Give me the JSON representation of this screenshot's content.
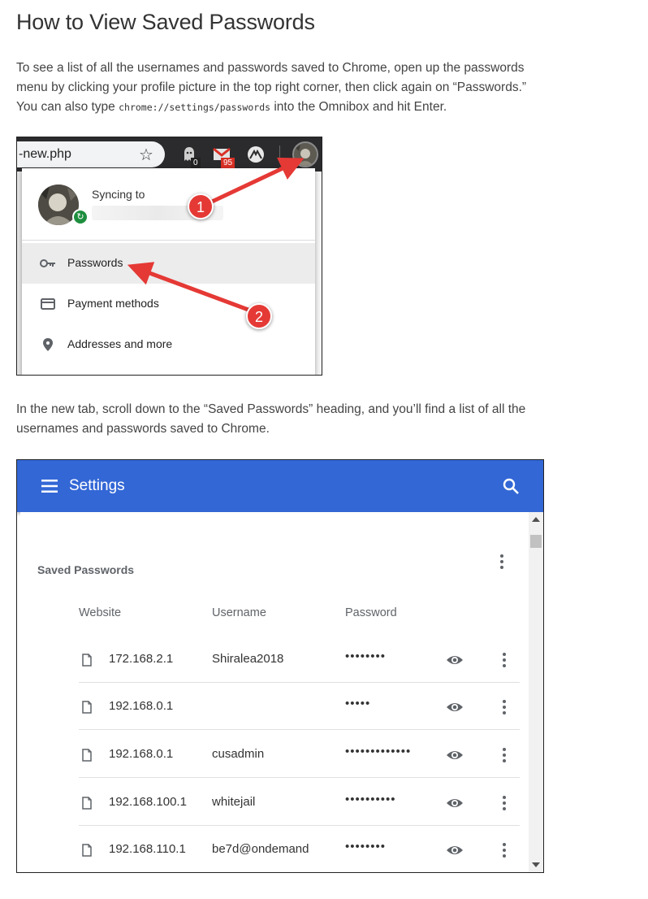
{
  "article": {
    "title": "How to View Saved Passwords",
    "para1": {
      "line1": "To see a list of all the usernames and passwords saved to Chrome, open up the passwords",
      "line2": "menu by clicking your profile picture in the top right corner, then click again on “Passwords.”",
      "line3_before": "You can also type ",
      "line3_code": "chrome://settings/passwords",
      "line3_after": " into the Omnibox and hit Enter."
    },
    "para2": {
      "line1": "In the new tab, scroll down to the “Saved Passwords” heading, and you’ll find a list of all the",
      "line2": "usernames and passwords saved to Chrome."
    }
  },
  "figure1": {
    "omnibox_text": "-new.php",
    "star_icon": "star-icon",
    "ghost_badge": "0",
    "mail_badge": "95",
    "sync_label": "Syncing to",
    "menu_items": [
      {
        "label": "Passwords",
        "icon": "key-icon"
      },
      {
        "label": "Payment methods",
        "icon": "credit-card-icon"
      },
      {
        "label": "Addresses and more",
        "icon": "location-pin-icon"
      }
    ],
    "steps": [
      "1",
      "2"
    ],
    "colors": {
      "toolbar": "#2b2b2d",
      "callout": "#e53935",
      "sync_badge": "#1e8e3e"
    }
  },
  "figure2": {
    "header_title": "Settings",
    "section_title": "Saved Passwords",
    "columns": {
      "website": "Website",
      "username": "Username",
      "password": "Password"
    },
    "rows": [
      {
        "site": "172.168.2.1",
        "username": "Shiralea2018",
        "password": "••••••••"
      },
      {
        "site": "192.168.0.1",
        "username": "",
        "password": "•••••"
      },
      {
        "site": "192.168.0.1",
        "username": "cusadmin",
        "password": "•••••••••••••"
      },
      {
        "site": "192.168.100.1",
        "username": "whitejail",
        "password": "••••••••••"
      },
      {
        "site": "192.168.110.1",
        "username": "be7d@ondemand",
        "password": "••••••••"
      }
    ],
    "colors": {
      "app_bar": "#3367d6"
    }
  }
}
